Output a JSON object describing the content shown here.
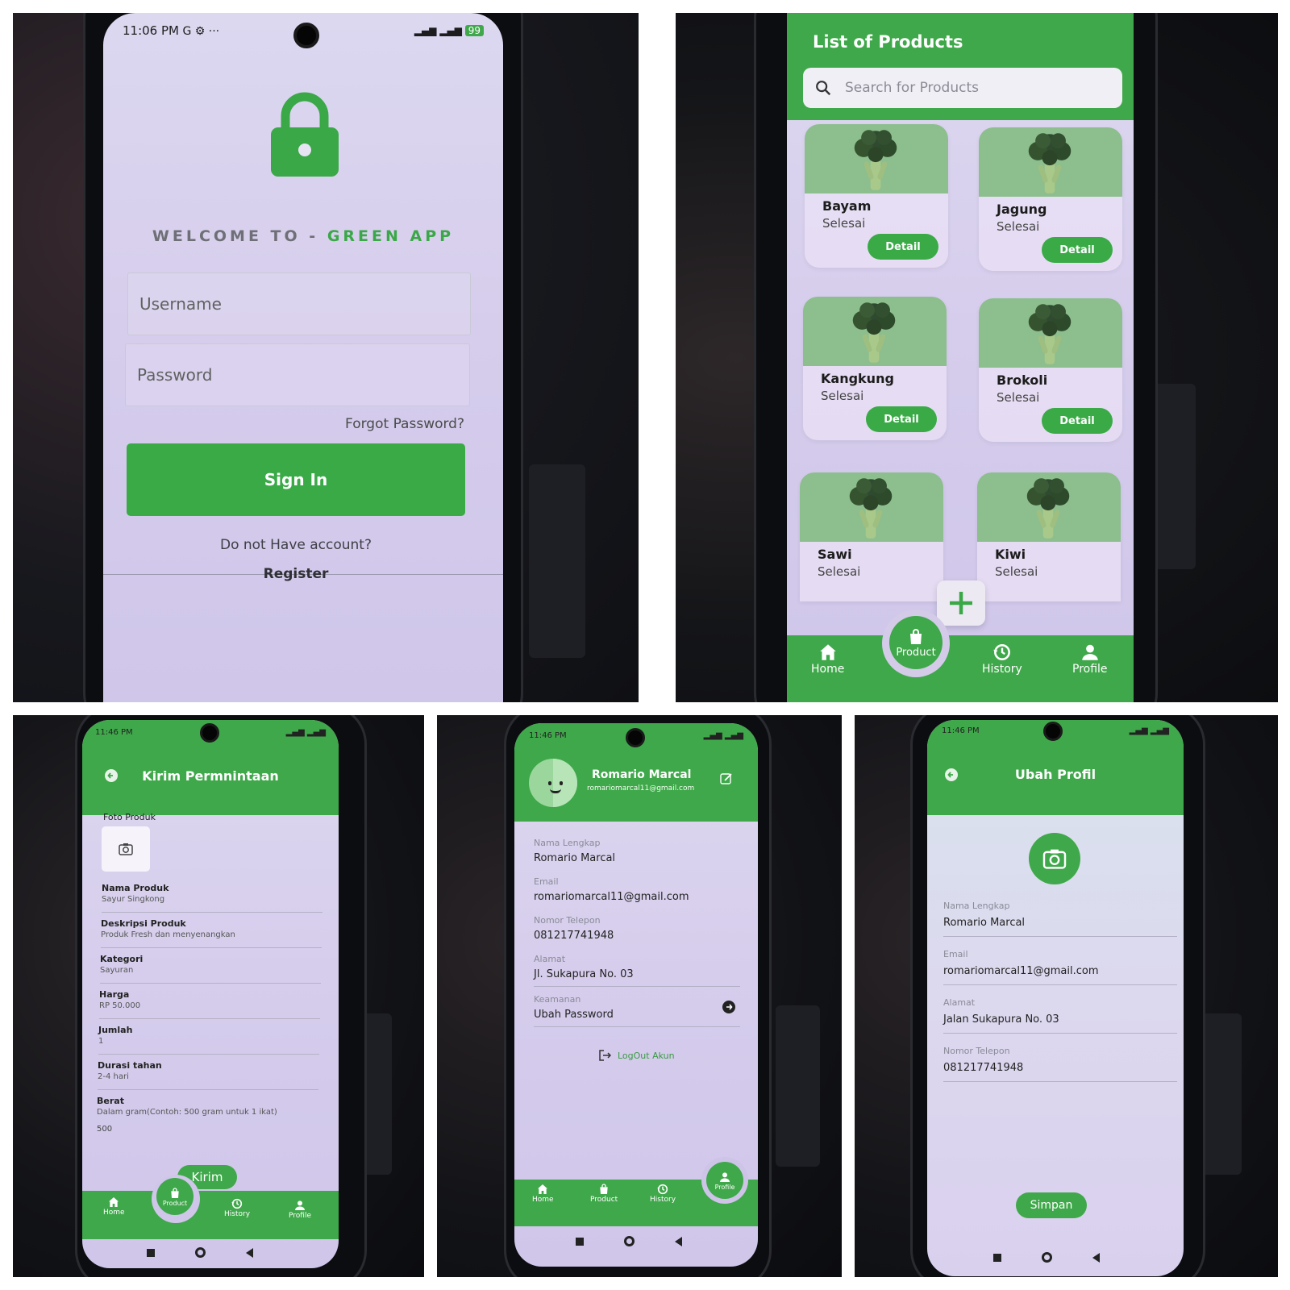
{
  "login": {
    "status_time": "11:06 PM",
    "status_extra": "G ⚙ ···",
    "battery": "99",
    "welcome_prefix": "WELCOME TO -",
    "welcome_app": "GREEN APP",
    "username_placeholder": "Username",
    "password_placeholder": "Password",
    "forgot": "Forgot Password?",
    "sign_in": "Sign In",
    "no_account": "Do not Have account?",
    "register": "Register"
  },
  "products": {
    "title": "List of Products",
    "search_placeholder": "Search for Products",
    "detail_label": "Detail",
    "items": [
      {
        "name": "Bayam",
        "status": "Selesai"
      },
      {
        "name": "Jagung",
        "status": "Selesai"
      },
      {
        "name": "Kangkung",
        "status": "Selesai"
      },
      {
        "name": "Brokoli",
        "status": "Selesai"
      },
      {
        "name": "Sawi",
        "status": "Selesai"
      },
      {
        "name": "Kiwi",
        "status": "Selesai"
      }
    ],
    "nav": {
      "home": "Home",
      "product": "Product",
      "history": "History",
      "profile": "Profile"
    }
  },
  "request": {
    "status_time": "11:46 PM",
    "title": "Kirim Permnintaan",
    "photo_label": "Foto Produk",
    "fields": [
      {
        "label": "Nama Produk",
        "value": "Sayur Singkong"
      },
      {
        "label": "Deskripsi Produk",
        "value": "Produk Fresh dan menyenangkan"
      },
      {
        "label": "Kategori",
        "value": "Sayuran"
      },
      {
        "label": "Harga",
        "value": "RP 50.000"
      },
      {
        "label": "Jumlah",
        "value": "1"
      },
      {
        "label": "Durasi tahan",
        "value": "2-4 hari"
      },
      {
        "label": "Berat",
        "value": "Dalam gram(Contoh: 500 gram untuk 1 ikat)"
      }
    ],
    "weight_value": "500",
    "submit": "Kirim",
    "nav": {
      "home": "Home",
      "product": "Product",
      "history": "History",
      "profile": "Profile"
    }
  },
  "profile": {
    "status_time": "11:46 PM",
    "name": "Romario Marcal",
    "email_header": "romariomarcal11@gmail.com",
    "fields": [
      {
        "label": "Nama Lengkap",
        "value": "Romario Marcal"
      },
      {
        "label": "Email",
        "value": "romariomarcal11@gmail.com"
      },
      {
        "label": "Nomor Telepon",
        "value": "081217741948"
      },
      {
        "label": "Alamat",
        "value": "Jl. Sukapura No. 03"
      },
      {
        "label": "Keamanan",
        "value": "Ubah Password"
      }
    ],
    "logout": "LogOut Akun",
    "nav": {
      "home": "Home",
      "product": "Product",
      "history": "History",
      "profile": "Profile"
    }
  },
  "edit": {
    "status_time": "11:46 PM",
    "title": "Ubah Profil",
    "fields": [
      {
        "label": "Nama Lengkap",
        "value": "Romario Marcal"
      },
      {
        "label": "Email",
        "value": "romariomarcal11@gmail.com"
      },
      {
        "label": "Alamat",
        "value": "Jalan Sukapura No. 03"
      },
      {
        "label": "Nomor Telepon",
        "value": "081217741948"
      }
    ],
    "save": "Simpan"
  },
  "colors": {
    "brand_green": "#3fa84a",
    "screen_lavender": "#d6cdec"
  },
  "icons": [
    "lock-icon",
    "search-icon",
    "plus-icon",
    "home-icon",
    "bag-icon",
    "history-icon",
    "person-icon",
    "camera-icon",
    "back-icon",
    "edit-icon",
    "logout-icon",
    "arrow-right-icon"
  ]
}
